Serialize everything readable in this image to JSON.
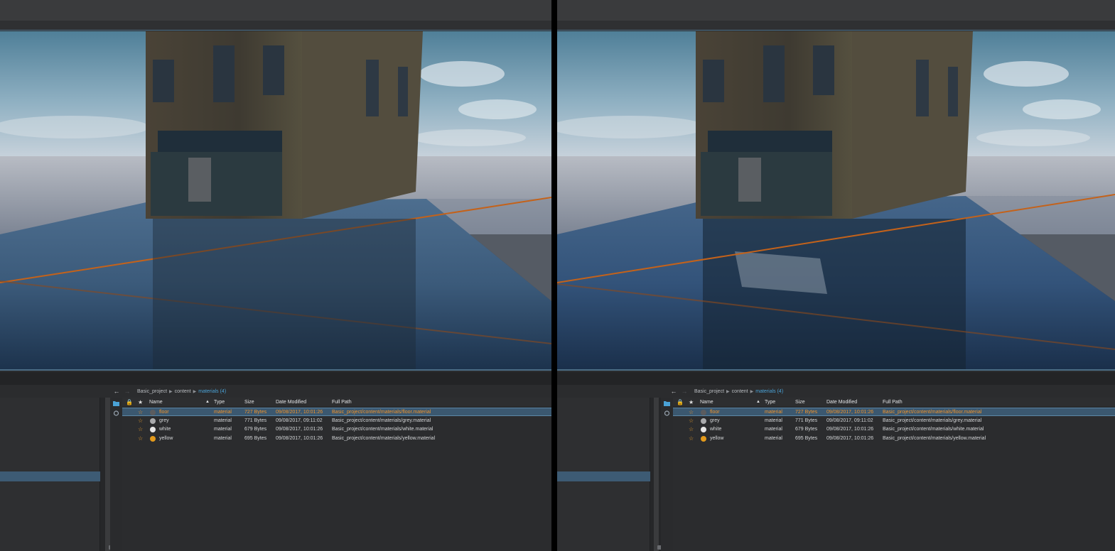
{
  "colors": {
    "accent_orange": "#f0932b",
    "accent_blue": "#4aa2d6",
    "selection": "#3b5870",
    "panel_bg": "#2b2c2e"
  },
  "breadcrumb": {
    "root": "Basic_project",
    "mid": "content",
    "current": "materials (4)"
  },
  "columns": {
    "name": "Name",
    "type": "Type",
    "size": "Size",
    "date": "Date Modified",
    "path": "Full Path"
  },
  "files": [
    {
      "name": "floor",
      "type": "material",
      "size": "727 Bytes",
      "date": "09/08/2017, 10:01:26",
      "path": "Basic_project/content/materials/floor.material",
      "dot": "#5b5c5f",
      "selected": true
    },
    {
      "name": "grey",
      "type": "material",
      "size": "771 Bytes",
      "date": "09/08/2017, 09:11:02",
      "path": "Basic_project/content/materials/grey.material",
      "dot": "#a9aaac",
      "selected": false
    },
    {
      "name": "white",
      "type": "material",
      "size": "679 Bytes",
      "date": "09/08/2017, 10:01:26",
      "path": "Basic_project/content/materials/white.material",
      "dot": "#e6e6e6",
      "selected": false
    },
    {
      "name": "yellow",
      "type": "material",
      "size": "695 Bytes",
      "date": "09/08/2017, 10:01:26",
      "path": "Basic_project/content/materials/yellow.material",
      "dot": "#e39a1c",
      "selected": false
    }
  ],
  "icons": {
    "back": "arrow-left-icon",
    "forward": "arrow-right-icon",
    "lock": "lock-icon",
    "favorite": "star-icon",
    "folder": "folder-icon"
  }
}
